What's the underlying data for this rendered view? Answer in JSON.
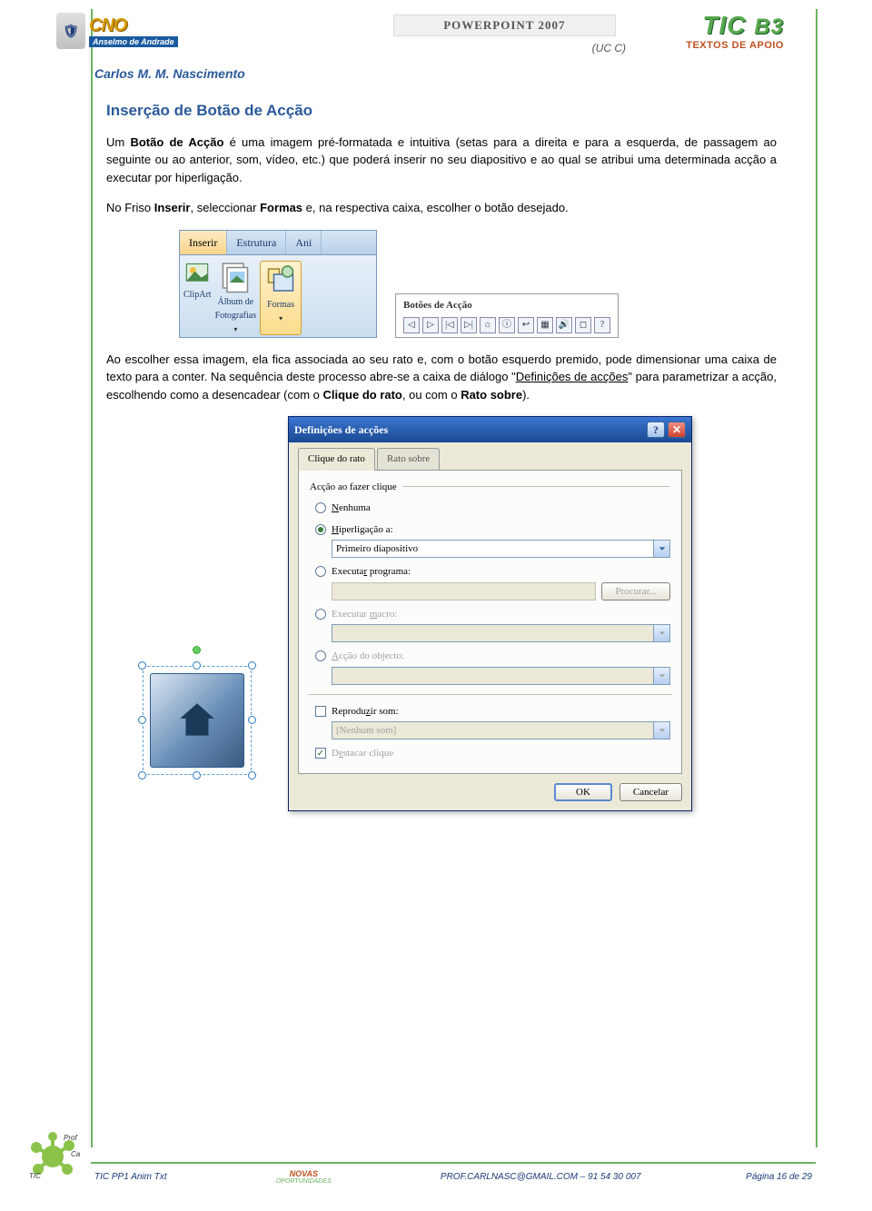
{
  "header": {
    "cno_badge": "R\nV\nC\nC",
    "cno_text": "CNO",
    "cno_sub": "Anselmo de Andrade",
    "app_title": "POWERPOINT 2007",
    "ucc": "(UC C)",
    "tic": "TIC",
    "b3": "B3",
    "apoio": "TEXTOS DE APOIO",
    "author": "Carlos M. M. Nascimento"
  },
  "section_title": "Inserção de Botão de Acção",
  "para1_a": "Um ",
  "para1_bold": "Botão de Acção",
  "para1_b": " é uma imagem pré-formatada e intuitiva (setas para a direita e para a esquerda, de passagem ao seguinte ou ao anterior, som, vídeo, etc.) que poderá inserir no seu diapositivo e ao qual se atribui uma determinada acção a executar por hiperligação.",
  "para2_a": "No Friso ",
  "para2_b1": "Inserir",
  "para2_b": ", seleccionar ",
  "para2_b2": "Formas",
  "para2_c": " e, na respectiva caixa, escolher o botão desejado.",
  "ribbon": {
    "tabs": [
      "Inserir",
      "Estrutura",
      "Ani"
    ],
    "groups": [
      {
        "label": "ClipArt",
        "small": true
      },
      {
        "label": "Álbum de\nFotografias",
        "dd": true
      },
      {
        "label": "Formas",
        "selected": true
      }
    ],
    "shapes_panel_title": "Botões de Acção",
    "shape_glyphs": [
      "◁",
      "▷",
      "|◁",
      "▷|",
      "⌂",
      "ⓘ",
      "↩",
      "▦",
      "🔊",
      "◻",
      "?"
    ]
  },
  "para3_a": "Ao escolher essa imagem, ela fica associada ao seu rato e, com o botão esquerdo premido, pode dimensionar uma caixa de texto para a conter. Na sequência deste processo abre-se a caixa de diálogo \"",
  "para3_u": "Definições de acções",
  "para3_b": "\" para parametrizar a acção, escolhendo como a desencadear (com o ",
  "para3_bold1": "Clique do rato",
  "para3_c": ", ou com o ",
  "para3_bold2": "Rato sobre",
  "para3_d": ").",
  "dialog": {
    "title": "Definições de acções",
    "tab_active": "Clique do rato",
    "tab_inactive": "Rato sobre",
    "legend": "Acção ao fazer clique",
    "r_none": "Nenhuma",
    "r_hyper": "Hiperligação a:",
    "hyper_value": "Primeiro diapositivo",
    "r_exec": "Executar programa:",
    "browse": "Procurar...",
    "r_macro": "Executar macro:",
    "r_obj": "Acção do objecto:",
    "chk_sound": "Reproduzir som:",
    "sound_value": "[Nenhum som]",
    "chk_highlight": "Destacar clique",
    "btn_ok": "OK",
    "btn_cancel": "Cancelar"
  },
  "footer": {
    "doc": "TIC PP1 Anim Txt",
    "novas": "NOVAS",
    "oport": "OPORTUNIDADES",
    "email": "PROF.CARLNASC@GMAIL.COM – 91 54 30 007",
    "page": "Página 16 de 29"
  }
}
